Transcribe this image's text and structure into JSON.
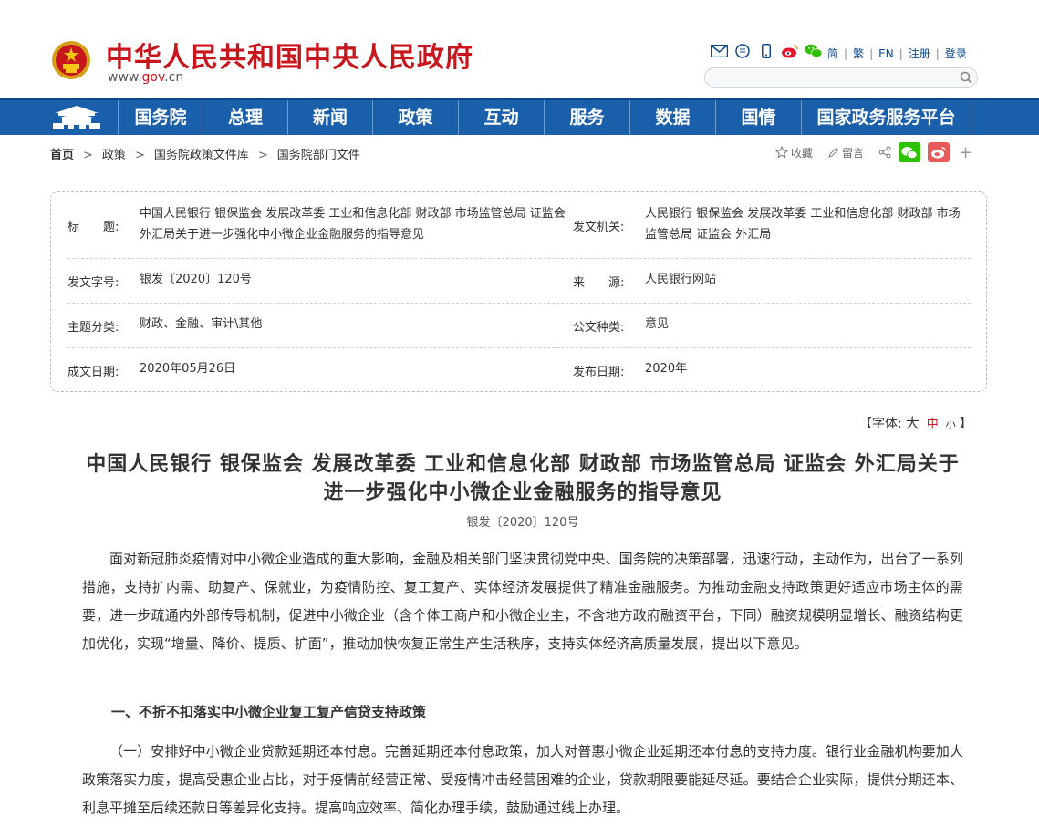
{
  "header": {
    "site_title": "中华人民共和国中央人民政府",
    "url_prefix": "www.",
    "url_red": "gov",
    "url_suffix": ".cn",
    "top_icons": [
      "mail-icon",
      "message-icon",
      "mobile-icon",
      "weibo-icon",
      "wechat-icon"
    ],
    "links": [
      "简",
      "繁",
      "EN",
      "注册",
      "登录"
    ],
    "search_placeholder": ""
  },
  "nav": {
    "items": [
      "国务院",
      "总理",
      "新闻",
      "政策",
      "互动",
      "服务",
      "数据",
      "国情",
      "国家政务服务平台"
    ]
  },
  "breadcrumb": [
    "首页",
    "政策",
    "国务院政策文件库",
    "国务院部门文件"
  ],
  "tools": {
    "favorite": "收藏",
    "comment": "留言"
  },
  "info": {
    "title_label": "标　　题:",
    "title_value": "中国人民银行 银保监会 发展改革委 工业和信息化部 财政部 市场监管总局 证监会 外汇局关于进一步强化中小微企业金融服务的指导意见",
    "issuer_label": "发文机关:",
    "issuer_value": "人民银行 银保监会 发展改革委 工业和信息化部 财政部 市场监管总局 证监会 外汇局",
    "docno_label": "发文字号:",
    "docno_value": "银发〔2020〕120号",
    "source_label": "来　　源:",
    "source_value": "人民银行网站",
    "topic_label": "主题分类:",
    "topic_value": "财政、金融、审计\\其他",
    "type_label": "公文种类:",
    "type_value": "意见",
    "written_label": "成文日期:",
    "written_value": "2020年05月26日",
    "published_label": "发布日期:",
    "published_value": "2020年"
  },
  "fontsize": {
    "prefix": "【字体:",
    "big": "大",
    "mid": "中",
    "small": "小",
    "suffix": "】"
  },
  "article": {
    "title": "中国人民银行 银保监会 发展改革委 工业和信息化部 财政部 市场监管总局 证监会 外汇局关于进一步强化中小微企业金融服务的指导意见",
    "doc_no": "银发〔2020〕120号",
    "para1": "面对新冠肺炎疫情对中小微企业造成的重大影响，金融及相关部门坚决贯彻党中央、国务院的决策部署，迅速行动，主动作为，出台了一系列措施，支持扩内需、助复产、保就业，为疫情防控、复工复产、实体经济发展提供了精准金融服务。为推动金融支持政策更好适应市场主体的需要，进一步疏通内外部传导机制，促进中小微企业（含个体工商户和小微企业主，不含地方政府融资平台，下同）融资规模明显增长、融资结构更加优化，实现“增量、降价、提质、扩面”，推动加快恢复正常生产生活秩序，支持实体经济高质量发展，提出以下意见。",
    "section1": "一、不折不扣落实中小微企业复工复产信贷支持政策",
    "para2": "（一）安排好中小微企业贷款延期还本付息。完善延期还本付息政策，加大对普惠小微企业延期还本付息的支持力度。银行业金融机构要加大政策落实力度，提高受惠企业占比，对于疫情前经营正常、受疫情冲击经营困难的企业，贷款期限要能延尽延。要结合企业实际，提供分期还本、利息平摊至后续还款日等差异化支持。提高响应效率、简化办理手续，鼓励通过线上办理。"
  },
  "colors": {
    "brand_red": "#c8161d",
    "nav_blue": "#1a5fa9",
    "wechat_green": "#2dc100",
    "weibo_red": "#e6162d"
  }
}
